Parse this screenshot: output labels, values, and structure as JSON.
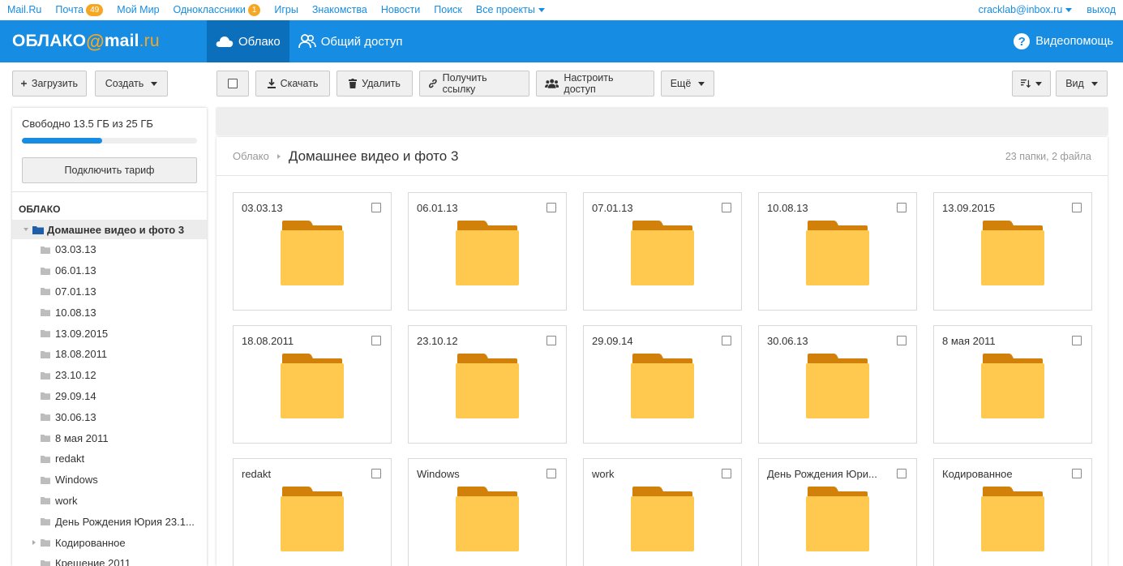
{
  "portal": {
    "links": [
      "Mail.Ru",
      "Почта",
      "Мой Мир",
      "Одноклассники",
      "Игры",
      "Знакомства",
      "Новости",
      "Поиск",
      "Все проекты"
    ],
    "mail_badge": "49",
    "ok_badge": "1",
    "user": "cracklab@inbox.ru",
    "logout": "выход"
  },
  "header": {
    "logo_main": "ОБЛАКО",
    "logo_at": "@",
    "logo_mail": "mail",
    "logo_ru": ".ru",
    "tab_cloud": "Облако",
    "tab_shared": "Общий доступ",
    "help": "Видеопомощь"
  },
  "toolbar": {
    "upload": "Загрузить",
    "create": "Создать",
    "download": "Скачать",
    "delete": "Удалить",
    "get_link": "Получить ссылку",
    "access": "Настроить доступ",
    "more": "Ещё",
    "view": "Вид"
  },
  "sidebar": {
    "quota": "Свободно 13.5 ГБ из 25 ГБ",
    "quota_used_fraction": 0.46,
    "tariff": "Подключить тариф",
    "section": "ОБЛАКО",
    "root": "Домашнее видео и фото 3",
    "items": [
      "03.03.13",
      "06.01.13",
      "07.01.13",
      "10.08.13",
      "13.09.2015",
      "18.08.2011",
      "23.10.12",
      "29.09.14",
      "30.06.13",
      "8 мая 2011",
      "redakt",
      "Windows",
      "work",
      "День Рождения Юрия 23.1...",
      "Кодированное",
      "Крещение 2011"
    ]
  },
  "main": {
    "crumb_root": "Облако",
    "crumb_current": "Домашнее видео и фото 3",
    "count": "23 папки, 2 файла",
    "folders": [
      "03.03.13",
      "06.01.13",
      "07.01.13",
      "10.08.13",
      "13.09.2015",
      "18.08.2011",
      "23.10.12",
      "29.09.14",
      "30.06.13",
      "8 мая 2011",
      "redakt",
      "Windows",
      "work",
      "День Рождения Юри...",
      "Кодированное"
    ]
  },
  "colors": {
    "brand": "#168de2",
    "accent": "#f5a623",
    "folder_front": "#ffc94f",
    "folder_back": "#d1800a"
  }
}
